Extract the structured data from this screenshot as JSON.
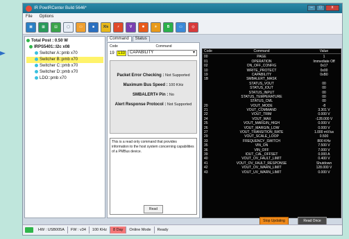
{
  "window": {
    "title": "IR PowIRCenter Build 5646*"
  },
  "menu": [
    "File",
    "Options"
  ],
  "toolbar_icons": [
    "dashboard-icon",
    "grid-icon",
    "chart-icon",
    "document-icon",
    "page-icon",
    "save-icon",
    "xls-icon",
    "rail-icon",
    "vout-icon",
    "fault-icon",
    "power-icon",
    "bus-icon",
    "monitor-icon",
    "lifebuoy-icon"
  ],
  "tree": {
    "total": "Total Post : 0.50 W",
    "device": "IRPS5401::I2c x08",
    "items": [
      "Switcher A::pmb x70",
      "Switcher B::pmb x70",
      "Switcher C::pmb x70",
      "Switcher D::pmb x70",
      "LDO::pmb x70"
    ],
    "selected_index": 1
  },
  "tabs": {
    "command": "Command",
    "status": "Status"
  },
  "command": {
    "code_label": "Code",
    "command_label": "Command",
    "code": "19",
    "hex": "133",
    "name": "CAPABILITY",
    "info": [
      {
        "label": "Packet Error Checking :",
        "value": "Not Supported"
      },
      {
        "label": "Maximum Bus Speed :",
        "value": "100 KHz"
      },
      {
        "label": "SMBALERT# Pin :",
        "value": "No"
      },
      {
        "label": "Alert Response Protocol :",
        "value": "Not Supported"
      }
    ],
    "description": "This is a read only command that provides information to the host system concerning capabilities of a PMBus device.",
    "read_button": "Read"
  },
  "registers": {
    "headers": [
      "Code",
      "Command",
      "Value"
    ],
    "rows": [
      [
        "00",
        "PAGE",
        "1"
      ],
      [
        "01",
        "OPERATION",
        "Immediate Off"
      ],
      [
        "02",
        "ON_OFF_CONFIG",
        "0x17"
      ],
      [
        "10",
        "WRITE_PROTECT",
        "0x00"
      ],
      [
        "19",
        "CAPABILITY",
        "0xB0"
      ],
      [
        "1B",
        "SMBALERT_MASK",
        ""
      ],
      [
        "",
        "STATUS_VOUT",
        "00"
      ],
      [
        "",
        "STATUS_IOUT",
        "00"
      ],
      [
        "",
        "STATUS_INPUT",
        "00"
      ],
      [
        "",
        "STATUS_TEMPERATURE",
        "00"
      ],
      [
        "",
        "STATUS_CML",
        "00"
      ],
      [
        "20",
        "VOUT_MODE",
        "-8"
      ],
      [
        "21",
        "VOUT_COMMAND",
        "3.301 V"
      ],
      [
        "22",
        "VOUT_TRIM",
        "0.000 V"
      ],
      [
        "24",
        "VOUT_MAX",
        "-128.000 V"
      ],
      [
        "25",
        "VOUT_MARGIN_HIGH",
        "0.000 V"
      ],
      [
        "26",
        "VOUT_MARGIN_LOW",
        "0.000 V"
      ],
      [
        "27",
        "VOUT_TRANSITION_RATE",
        "1.000 mV/us"
      ],
      [
        "29",
        "VOUT_SCALE_LOOP",
        "0.500"
      ],
      [
        "33",
        "FREQUENCY_SWITCH",
        "800 KHz"
      ],
      [
        "35",
        "VIN_ON",
        "7.500 V"
      ],
      [
        "36",
        "VIN_OFF",
        "7.000 V"
      ],
      [
        "39",
        "IOUT_CAL_OFFSET",
        "0.000 A"
      ],
      [
        "40",
        "VOUT_OV_FAULT_LIMIT",
        "0.400 V"
      ],
      [
        "41",
        "VOUT_OV_FAULT_RESPONSE",
        "Shutdown"
      ],
      [
        "42",
        "VOUT_OV_WARN_LIMIT",
        "128.000 V"
      ],
      [
        "43",
        "VOUT_UV_WARN_LIMIT",
        "0.000 V"
      ]
    ]
  },
  "buttons": {
    "stop": "Stop Updating",
    "read_once": "Read Once"
  },
  "status": {
    "hw": "HW : USB005A",
    "fw": "FW : v34",
    "speed": "100 KHz",
    "day": "8 Day",
    "mode": "Online Mode",
    "state": "Ready"
  }
}
